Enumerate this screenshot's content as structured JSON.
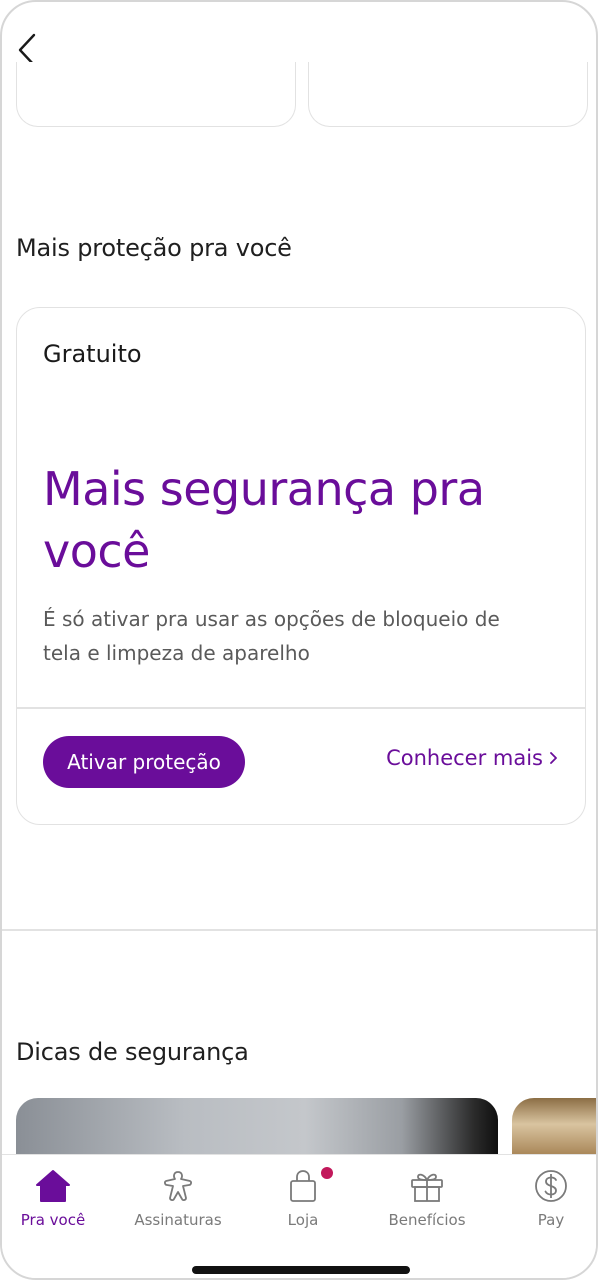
{
  "sections": {
    "protection_title": "Mais proteção pra você",
    "tips_title": "Dicas de segurança"
  },
  "protection_card": {
    "tier": "Gratuito",
    "headline": "Mais segurança pra você",
    "description": "É só ativar pra usar as opções de bloqueio de tela e limpeza de aparelho",
    "cta_label": "Ativar proteção",
    "more_label": "Conhecer mais"
  },
  "tabs": [
    {
      "label": "Pra você",
      "icon": "home-icon",
      "active": true
    },
    {
      "label": "Assinaturas",
      "icon": "subscriptions-icon",
      "active": false
    },
    {
      "label": "Loja",
      "icon": "shopping-bag-icon",
      "active": false,
      "badge": true
    },
    {
      "label": "Benefícios",
      "icon": "gift-icon",
      "active": false
    },
    {
      "label": "Pay",
      "icon": "dollar-circle-icon",
      "active": false
    }
  ],
  "colors": {
    "accent": "#6a0d9a",
    "badge": "#c2185b",
    "inactive": "#7a7a7a"
  }
}
